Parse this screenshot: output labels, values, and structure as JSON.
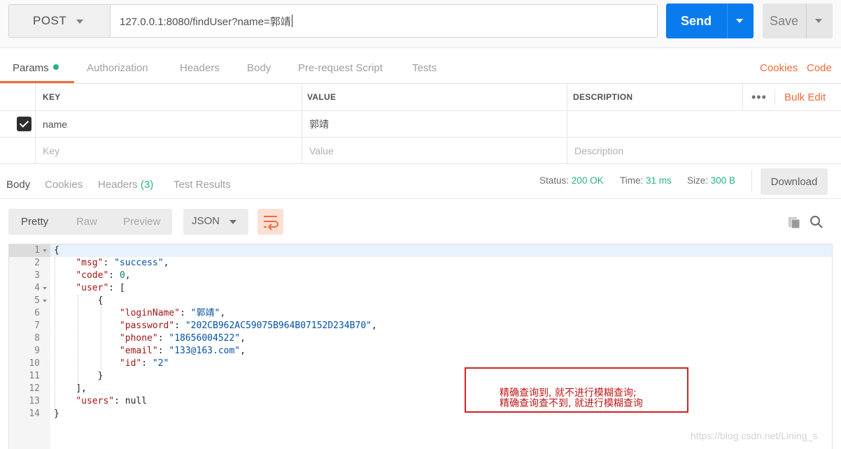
{
  "request": {
    "method": "POST",
    "url": "127.0.0.1:8080/findUser?name=郭靖",
    "send_label": "Send",
    "save_label": "Save"
  },
  "request_tabs": {
    "params": "Params",
    "authorization": "Authorization",
    "headers": "Headers",
    "body": "Body",
    "prerequest": "Pre-request Script",
    "tests": "Tests",
    "cookies": "Cookies",
    "code": "Code"
  },
  "params_table": {
    "headers": {
      "key": "KEY",
      "value": "VALUE",
      "description": "DESCRIPTION",
      "more": "•••",
      "bulk_edit": "Bulk Edit"
    },
    "rows": [
      {
        "key": "name",
        "value": "郭靖",
        "checked": true
      }
    ],
    "placeholders": {
      "key": "Key",
      "value": "Value",
      "description": "Description"
    }
  },
  "response_tabs": {
    "body": "Body",
    "cookies": "Cookies",
    "headers": "Headers",
    "headers_count": "(3)",
    "test_results": "Test Results"
  },
  "response_meta": {
    "status_label": "Status:",
    "status_value": "200 OK",
    "time_label": "Time:",
    "time_value": "31 ms",
    "size_label": "Size:",
    "size_value": "300 B",
    "download_label": "Download"
  },
  "view": {
    "pretty": "Pretty",
    "raw": "Raw",
    "preview": "Preview",
    "format": "JSON"
  },
  "code_lines": [
    {
      "n": "1",
      "fold": true,
      "indent": 0,
      "tokens": [
        [
          "p",
          "{"
        ]
      ]
    },
    {
      "n": "2",
      "fold": false,
      "indent": 1,
      "tokens": [
        [
          "k",
          "\"msg\""
        ],
        [
          "p",
          ": "
        ],
        [
          "s",
          "\"success\""
        ],
        [
          "p",
          ","
        ]
      ]
    },
    {
      "n": "3",
      "fold": false,
      "indent": 1,
      "tokens": [
        [
          "k",
          "\"code\""
        ],
        [
          "p",
          ": "
        ],
        [
          "n",
          "0"
        ],
        [
          "p",
          ","
        ]
      ]
    },
    {
      "n": "4",
      "fold": true,
      "indent": 1,
      "tokens": [
        [
          "k",
          "\"user\""
        ],
        [
          "p",
          ": ["
        ]
      ]
    },
    {
      "n": "5",
      "fold": true,
      "indent": 2,
      "tokens": [
        [
          "p",
          "{"
        ]
      ]
    },
    {
      "n": "6",
      "fold": false,
      "indent": 3,
      "tokens": [
        [
          "k",
          "\"loginName\""
        ],
        [
          "p",
          ": "
        ],
        [
          "s",
          "\"郭靖\""
        ],
        [
          "p",
          ","
        ]
      ]
    },
    {
      "n": "7",
      "fold": false,
      "indent": 3,
      "tokens": [
        [
          "k",
          "\"password\""
        ],
        [
          "p",
          ": "
        ],
        [
          "s",
          "\"202CB962AC59075B964B07152D234B70\""
        ],
        [
          "p",
          ","
        ]
      ]
    },
    {
      "n": "8",
      "fold": false,
      "indent": 3,
      "tokens": [
        [
          "k",
          "\"phone\""
        ],
        [
          "p",
          ": "
        ],
        [
          "s",
          "\"18656004522\""
        ],
        [
          "p",
          ","
        ]
      ]
    },
    {
      "n": "9",
      "fold": false,
      "indent": 3,
      "tokens": [
        [
          "k",
          "\"email\""
        ],
        [
          "p",
          ": "
        ],
        [
          "s",
          "\"133@163.com\""
        ],
        [
          "p",
          ","
        ]
      ]
    },
    {
      "n": "10",
      "fold": false,
      "indent": 3,
      "tokens": [
        [
          "k",
          "\"id\""
        ],
        [
          "p",
          ": "
        ],
        [
          "s",
          "\"2\""
        ]
      ]
    },
    {
      "n": "11",
      "fold": false,
      "indent": 2,
      "tokens": [
        [
          "p",
          "}"
        ]
      ]
    },
    {
      "n": "12",
      "fold": false,
      "indent": 1,
      "tokens": [
        [
          "p",
          "],"
        ]
      ]
    },
    {
      "n": "13",
      "fold": false,
      "indent": 1,
      "tokens": [
        [
          "k",
          "\"users\""
        ],
        [
          "p",
          ": null"
        ]
      ]
    },
    {
      "n": "14",
      "fold": false,
      "indent": 0,
      "tokens": [
        [
          "p",
          "}"
        ]
      ]
    }
  ],
  "annotation": {
    "line1": "精确查询到, 就不进行模糊查询;",
    "line2": "精确查询查不到, 就进行模糊查询"
  },
  "watermark": "https://blog.csdn.net/Lining_s",
  "colors": {
    "send_blue": "#097bed",
    "accent_orange": "#f26b3a",
    "status_green": "#26b47f",
    "annotation_red": "#d42020"
  },
  "icons": [
    "chevron-down-icon",
    "check-icon",
    "more-icon",
    "wrap-lines-icon",
    "copy-icon",
    "search-icon"
  ]
}
